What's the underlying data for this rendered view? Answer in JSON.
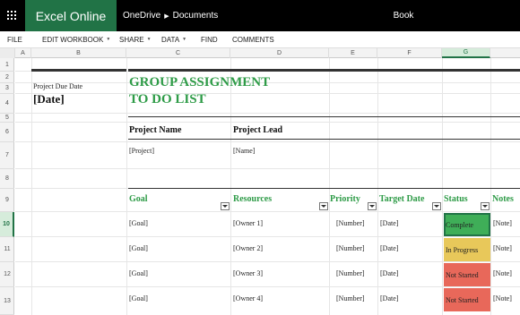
{
  "app": {
    "brand": "Excel Online",
    "breadcrumb": [
      "OneDrive",
      "Documents"
    ],
    "doc_title": "Book"
  },
  "ribbon": {
    "items": [
      "FILE",
      "EDIT WORKBOOK",
      "SHARE",
      "DATA",
      "FIND",
      "COMMENTS"
    ]
  },
  "columns": [
    "A",
    "B",
    "C",
    "D",
    "E",
    "F",
    "G"
  ],
  "selected_column": "G",
  "rows": [
    "1",
    "2",
    "3",
    "4",
    "5",
    "6",
    "7",
    "8",
    "9",
    "10",
    "11",
    "12",
    "13"
  ],
  "selected_row": "10",
  "sheet": {
    "due_label": "Project Due Date",
    "due_value": "[Date]",
    "title_line1": "GROUP ASSIGNMENT",
    "title_line2": "TO DO LIST",
    "project_name_header": "Project Name",
    "project_lead_header": "Project Lead",
    "project_name_value": "[Project]",
    "project_lead_value": "[Name]",
    "table_headers": {
      "goal": "Goal",
      "resources": "Resources",
      "priority": "Priority",
      "target_date": "Target Date",
      "status": "Status",
      "notes": "Notes"
    },
    "tasks": [
      {
        "goal": "[Goal]",
        "resources": "[Owner 1]",
        "priority": "[Number]",
        "target_date": "[Date]",
        "status": "Complete",
        "notes": "[Note]"
      },
      {
        "goal": "[Goal]",
        "resources": "[Owner 2]",
        "priority": "[Number]",
        "target_date": "[Date]",
        "status": "In Progress",
        "notes": "[Note]"
      },
      {
        "goal": "[Goal]",
        "resources": "[Owner 3]",
        "priority": "[Number]",
        "target_date": "[Date]",
        "status": "Not Started",
        "notes": "[Note]"
      },
      {
        "goal": "[Goal]",
        "resources": "[Owner 4]",
        "priority": "[Number]",
        "target_date": "[Date]",
        "status": "Not Started",
        "notes": "[Note]"
      }
    ]
  },
  "colors": {
    "brand_green": "#217346",
    "title_green": "#2e9b47",
    "status_complete": "#3fae58",
    "status_in_progress": "#e8c85a",
    "status_not_started": "#e8685a"
  },
  "icons": {
    "waffle": "app-launcher-icon",
    "breadcrumb_separator": "chevron-right-icon",
    "filter_dropdown": "filter-dropdown-icon"
  }
}
